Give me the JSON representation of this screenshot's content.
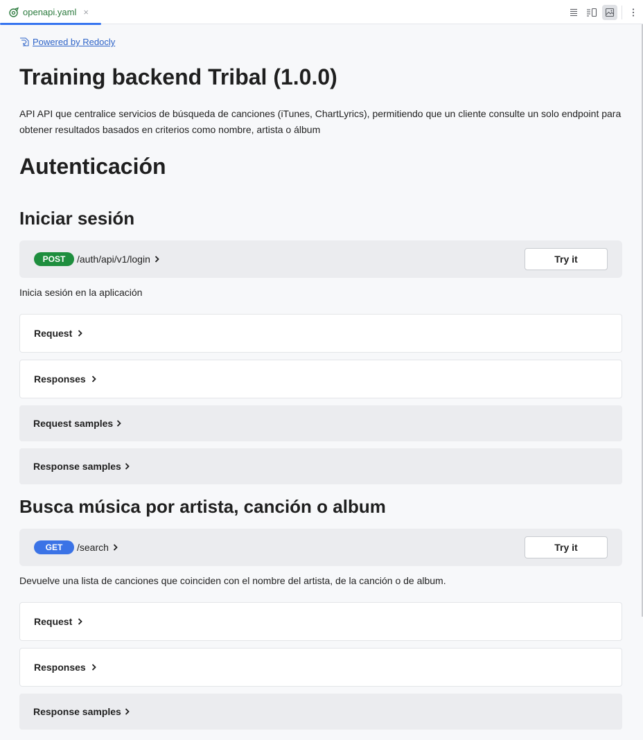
{
  "tab": {
    "filename": "openapi.yaml",
    "close": "×"
  },
  "powered_by": "Powered by Redocly",
  "api": {
    "title": "Training backend Tribal (1.0.0)",
    "description": "API API que centralice servicios de búsqueda de canciones (iTunes, ChartLyrics), permitiendo que un cliente consulte un solo endpoint para obtener resultados basados en criterios como nombre, artista o álbum"
  },
  "section": {
    "title": "Autenticación"
  },
  "operations": [
    {
      "title": "Iniciar sesión",
      "method": "POST",
      "path": "/auth/api/v1/login",
      "try_label": "Try it",
      "description": "Inicia sesión en la aplicación",
      "panels": [
        "Request",
        "Responses",
        "Request samples",
        "Response samples"
      ]
    },
    {
      "title": "Busca música por artista, canción o album",
      "method": "GET",
      "path": "/search",
      "try_label": "Try it",
      "description": "Devuelve una lista de canciones que coinciden con el nombre del artista, de la canción o de album.",
      "panels": [
        "Request",
        "Responses",
        "Response samples"
      ]
    }
  ],
  "colors": {
    "post": "#1e8e3e",
    "get": "#3b73e6",
    "link": "#2d63c8",
    "accent": "#3574f0"
  }
}
